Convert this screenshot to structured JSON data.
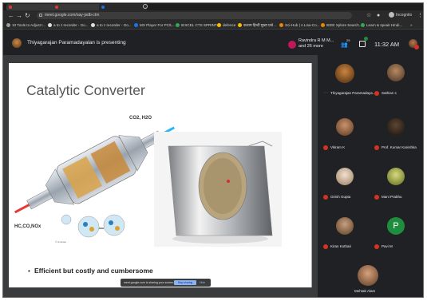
{
  "browser": {
    "url": "meet.google.com/oay-jsdb-ctm",
    "bookmarks": [
      "10 Tools to Adjust t...",
      "a to z recorder - Go...",
      "a to z recorder - Go...",
      "MX Player For PC/L...",
      "IEXCEL CTS SPRINT...",
      "defence",
      "कलाम हिन्दी मुख्य प्रश्ने...",
      "Sci-Hub | A Low-Co...",
      "IEEE Xplore Search...",
      "Learn & speak Hindi..."
    ],
    "incognito_label": "Incognito"
  },
  "meet": {
    "presenting_text": "Thiyagarajan Paramadayalan is presenting",
    "others_text": "Ravindra R M M... and 26 more",
    "people_count": "29",
    "time": "11:32 AM",
    "sharing_text": "meet.google.com is sharing your screen.",
    "stop_sharing": "Stop sharing",
    "hide": "Hide"
  },
  "slide": {
    "title": "Catalytic Converter",
    "gas_out": "CO2, H2O",
    "gas_in": "HC,CO,NOx",
    "credit": "© Umicore",
    "bullet": "Efficient but costly and cumbersome"
  },
  "participants": [
    {
      "name": "Thiyagarajan Paramadaya...",
      "muted": false,
      "color": "#6b3e1f"
    },
    {
      "name": "Sathian s",
      "muted": true,
      "color": "#7a5a3b"
    },
    {
      "name": "Vikram K",
      "muted": true,
      "color": "#8a5a3a"
    },
    {
      "name": "Prof. Kumar Kanishka",
      "muted": true,
      "color": "#2b2016"
    },
    {
      "name": "Girish Gupta",
      "muted": true,
      "color": "#b98a63"
    },
    {
      "name": "Mani Prabhu",
      "muted": true,
      "color": "#7d8a2f"
    },
    {
      "name": "Kiran Kothari",
      "muted": true,
      "color": "#9a6e4f"
    },
    {
      "name": "Pavi M",
      "muted": true,
      "letter": "P",
      "color": "#1e8e3e"
    }
  ],
  "bottom_participant": {
    "name": "Mehtab Alam"
  }
}
